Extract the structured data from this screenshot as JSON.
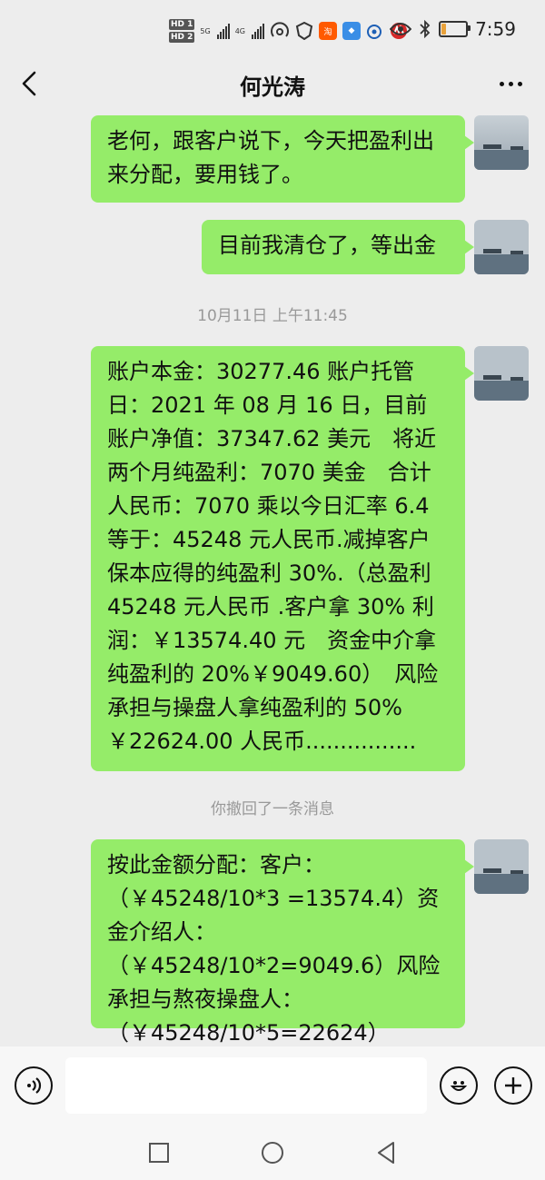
{
  "status_bar": {
    "sim_tags": [
      "HD 1",
      "HD 2"
    ],
    "network_labels": [
      "5G",
      "4G"
    ],
    "app_icons": [
      "taobao-icon",
      "blue-app-icon",
      "weibo-icon",
      "bank-icon"
    ],
    "battery_level": 0.18,
    "time": "7:59"
  },
  "chat": {
    "title": "何光涛",
    "messages": [
      {
        "type": "outgoing",
        "text": "老何，跟客户说下，今天把盈利出来分配，要用钱了。"
      },
      {
        "type": "outgoing",
        "text": "目前我清仓了，等出金"
      },
      {
        "type": "time",
        "text": "10月11日 上午11:45"
      },
      {
        "type": "outgoing",
        "text": "账户本金：30277.46 账户托管日：2021 年 08 月 16 日，目前账户净值：37347.62 美元　将近两个月纯盈利：7070 美金　合计人民币：7070 乘以今日汇率 6.4 等于：45248 元人民币.减掉客户保本应得的纯盈利 30%.（总盈利 45248 元人民币 .客户拿 30% 利润：￥13574.40 元　资金中介拿纯盈利的 20%￥9049.60）　风险承担与操盘人拿纯盈利的 50%￥22624.00 人民币................"
      },
      {
        "type": "system",
        "text": "你撤回了一条消息"
      },
      {
        "type": "outgoing",
        "text": "按此金额分配：客户：（￥45248/10*3 =13574.4）资金介绍人：（￥45248/10*2=9049.6）风险承担与熬夜操盘人：（￥45248/10*5=22624）"
      }
    ]
  },
  "input_bar": {
    "voice_icon": "voice-icon",
    "emoji_icon": "emoji-icon",
    "plus_icon": "plus-icon"
  },
  "colors": {
    "bubble": "#95ec69",
    "background": "#ededed",
    "system_text": "#999999"
  }
}
